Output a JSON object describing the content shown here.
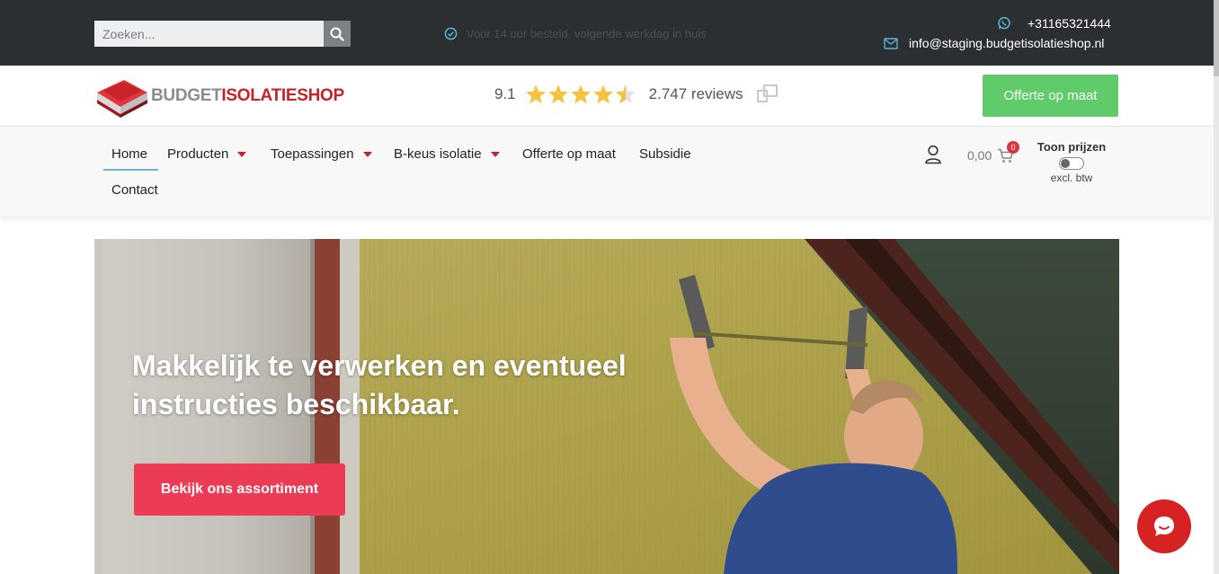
{
  "topbar": {
    "search_placeholder": "Zoeken...",
    "usp_text": "Voor 14 uur besteld, volgende werkdag in huis",
    "phone": "+31165321444",
    "email": "info@staging.budgetisolatieshop.nl"
  },
  "header": {
    "logo_part1": "BUDGET",
    "logo_part2": "ISOLATIESHOP",
    "rating_score": "9.1",
    "rating_stars": 4.5,
    "reviews": "2.747 reviews",
    "offerte_button": "Offerte op maat"
  },
  "nav": {
    "items": [
      {
        "label": "Home"
      },
      {
        "label": "Producten"
      },
      {
        "label": "Toepassingen"
      },
      {
        "label": "B-keus isolatie"
      },
      {
        "label": "Offerte op maat"
      },
      {
        "label": "Subsidie"
      },
      {
        "label": "Contact"
      }
    ],
    "cart_amount": "0,00",
    "cart_count": "0",
    "toon_prijzen": "Toon prijzen",
    "excl_btw": "excl. btw"
  },
  "hero": {
    "title": "Makkelijk te verwerken en eventueel instructies beschikbaar.",
    "button": "Bekijk ons assortiment"
  },
  "colors": {
    "topbar": "#2b2f31",
    "brand_red": "#c62229",
    "offerte_green": "#5fcb6b",
    "hero_button": "#ec3c55",
    "star": "#f5c242"
  }
}
